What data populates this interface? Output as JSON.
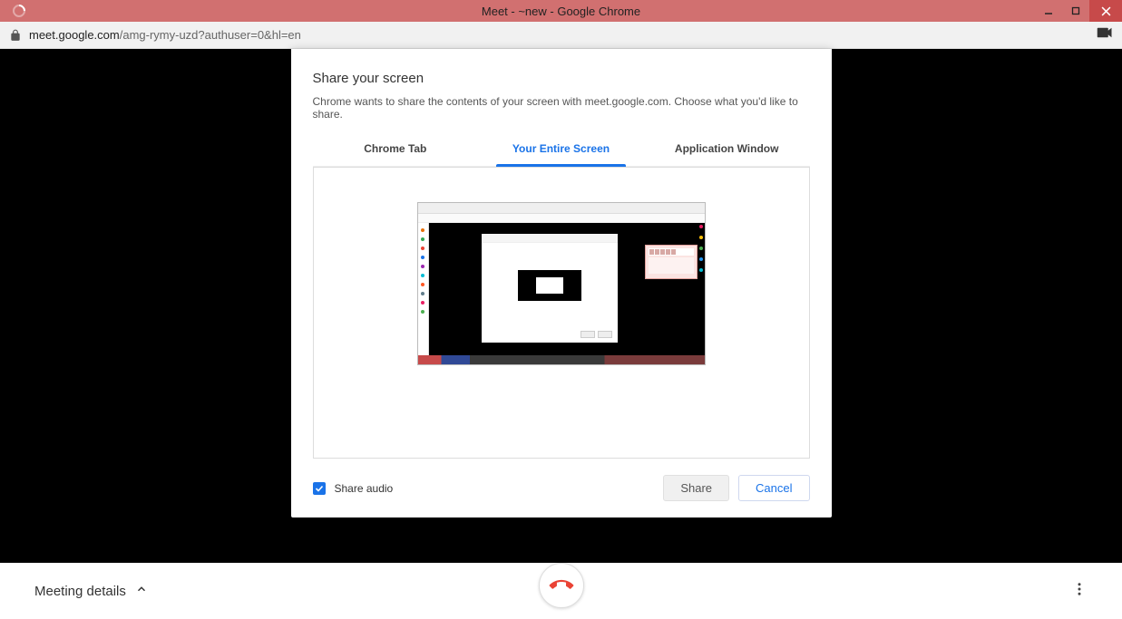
{
  "window": {
    "title": "Meet - ~new - Google Chrome"
  },
  "address": {
    "host": "meet.google.com",
    "path": "/amg-rymy-uzd?authuser=0&hl=en"
  },
  "dialog": {
    "title": "Share your screen",
    "description": "Chrome wants to share the contents of your screen with meet.google.com. Choose what you'd like to share.",
    "tabs": {
      "chrome_tab": "Chrome Tab",
      "entire_screen": "Your Entire Screen",
      "app_window": "Application Window"
    },
    "share_audio_label": "Share audio",
    "share_audio_checked": true,
    "buttons": {
      "share": "Share",
      "cancel": "Cancel"
    }
  },
  "meet_bar": {
    "meeting_details": "Meeting details"
  }
}
